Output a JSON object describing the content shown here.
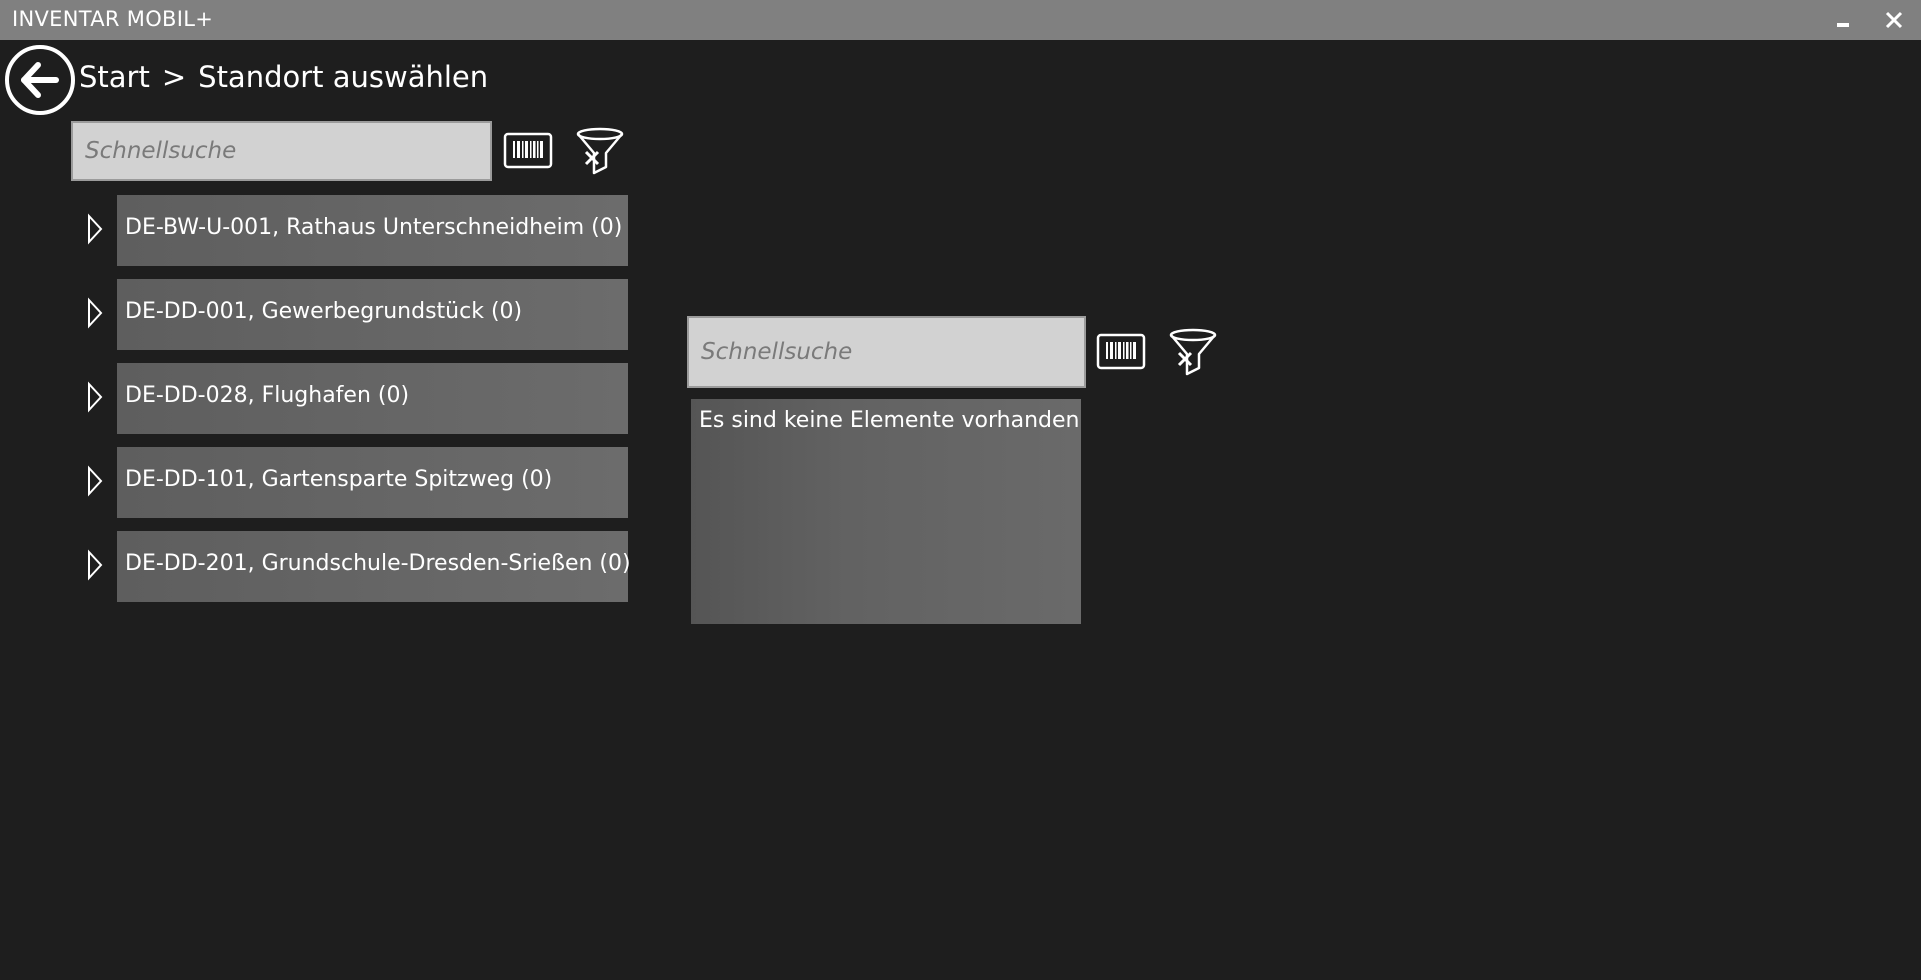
{
  "window": {
    "title": "INVENTAR MOBIL+",
    "minimize_icon": "minimize-icon",
    "close_icon": "close-icon"
  },
  "header": {
    "back_icon": "back-arrow-icon",
    "breadcrumb": {
      "root": "Start",
      "separator": ">",
      "current": "Standort auswählen"
    }
  },
  "left_panel": {
    "search": {
      "placeholder": "Schnellsuche",
      "value": ""
    },
    "barcode_icon": "barcode-icon",
    "filter_clear_icon": "filter-clear-icon",
    "locations": [
      {
        "label": "DE-BW-U-001, Rathaus Unterschneidheim (0)"
      },
      {
        "label": "DE-DD-001, Gewerbegrundstück (0)"
      },
      {
        "label": "DE-DD-028, Flughafen (0)"
      },
      {
        "label": "DE-DD-101, Gartensparte Spitzweg (0)"
      },
      {
        "label": "DE-DD-201, Grundschule-Dresden-Srießen (0)"
      }
    ]
  },
  "right_panel": {
    "search": {
      "placeholder": "Schnellsuche",
      "value": ""
    },
    "barcode_icon": "barcode-icon",
    "filter_clear_icon": "filter-clear-icon",
    "empty_message": "Es sind keine Elemente vorhanden"
  },
  "colors": {
    "background": "#1e1e1e",
    "titlebar": "#808080",
    "item_bg": "#666666",
    "search_bg": "#d2d2d2"
  }
}
